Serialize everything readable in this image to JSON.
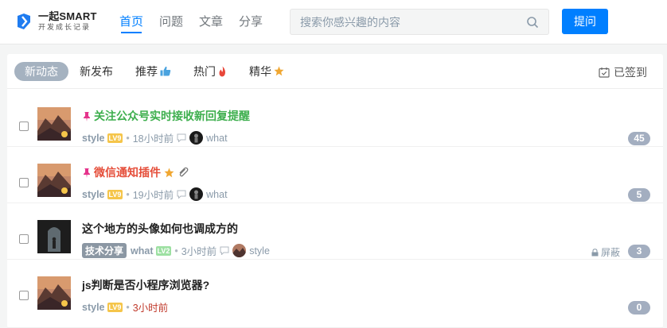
{
  "logo": {
    "title": "一起SMART",
    "subtitle": "开发成长记录"
  },
  "nav": [
    {
      "label": "首页",
      "active": true
    },
    {
      "label": "问题",
      "active": false
    },
    {
      "label": "文章",
      "active": false
    },
    {
      "label": "分享",
      "active": false
    }
  ],
  "search": {
    "placeholder": "搜索你感兴趣的内容",
    "value": ""
  },
  "ask_button": "提问",
  "tabs": [
    {
      "label": "新动态",
      "active": true,
      "icon": ""
    },
    {
      "label": "新发布",
      "active": false,
      "icon": ""
    },
    {
      "label": "推荐",
      "active": false,
      "icon": "thumbs-up-icon"
    },
    {
      "label": "热门",
      "active": false,
      "icon": "fire-icon"
    },
    {
      "label": "精华",
      "active": false,
      "icon": "star-icon"
    }
  ],
  "signed_label": "已签到",
  "posts": [
    {
      "title": "关注公众号实时接收新回复提醒",
      "pinned": true,
      "title_color": "green",
      "author": "style",
      "level": "LV9",
      "time": "18小时前",
      "replier": "what",
      "count": "45"
    },
    {
      "title": "微信通知插件",
      "pinned": true,
      "title_color": "red",
      "starred": true,
      "attachment": true,
      "author": "style",
      "level": "LV9",
      "time": "19小时前",
      "replier": "what",
      "count": "5"
    },
    {
      "title": "这个地方的头像如何也调成方的",
      "pinned": false,
      "title_color": "default",
      "tag": "技术分享",
      "author": "what",
      "level": "LV2",
      "time": "3小时前",
      "replier": "style",
      "blocked_label": "屏蔽",
      "count": "3"
    },
    {
      "title": "js判断是否小程序浏览器?",
      "pinned": false,
      "title_color": "default",
      "author": "style",
      "level": "LV9",
      "time": "3小时前",
      "count": "0"
    }
  ],
  "colors": {
    "accent": "#007fff",
    "pinned": "#e5338b",
    "green_title": "#3eaf4e",
    "red_title": "#e54e3a"
  }
}
